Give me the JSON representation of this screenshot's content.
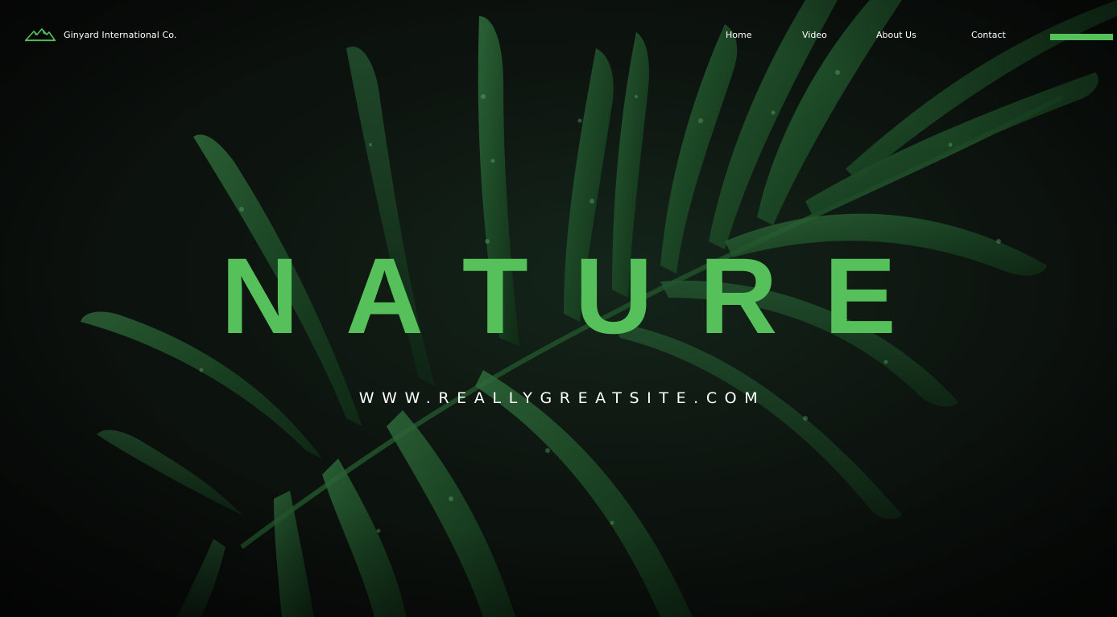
{
  "header": {
    "brand_name": "Ginyard International Co.",
    "logo_icon": "mountain-logo-icon"
  },
  "nav": {
    "items": [
      {
        "label": "Home"
      },
      {
        "label": "Video"
      },
      {
        "label": "About Us"
      },
      {
        "label": "Contact"
      }
    ],
    "menu_icon": "menu-bar-icon"
  },
  "hero": {
    "title": "NATURE",
    "url": "WWW.REALLYGREATSITE.COM"
  },
  "colors": {
    "accent": "#56c15a",
    "background": "#0b0d0c",
    "text": "#ffffff"
  },
  "background_image": "dark-green-palm-leaves-with-water-droplets"
}
